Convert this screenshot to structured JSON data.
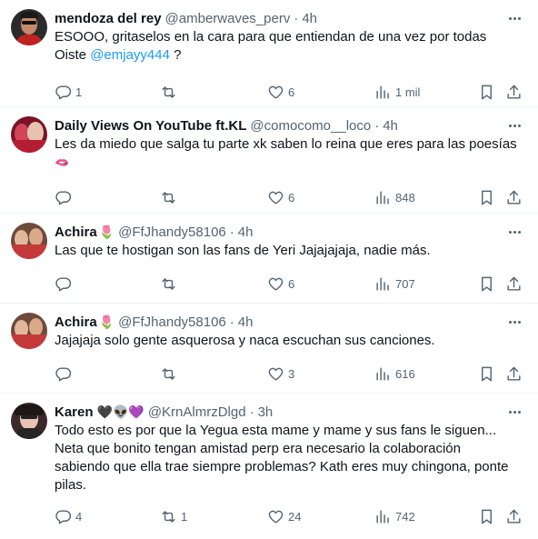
{
  "tweets": [
    {
      "name": "mendoza del rey",
      "name_emoji": "",
      "handle": "@amberwaves_perv",
      "time": "4h",
      "text_lines": [
        "ESOOO, gritaselos en la cara para que entiendan de una vez por todas"
      ],
      "text_line2_prefix": "Oiste ",
      "mention": "@emjayy444",
      "text_line2_suffix": " ?",
      "replies": "1",
      "retweets": "",
      "likes": "6",
      "views": "1 mil"
    },
    {
      "name": "Daily Views On YouTube ft.KL",
      "name_emoji": "",
      "handle": "@comocomo__loco",
      "time": "4h",
      "text_lines": [
        "Les da miedo que salga tu parte xk saben lo reina que eres para las poesías",
        "🫦"
      ],
      "replies": "",
      "retweets": "",
      "likes": "6",
      "views": "848"
    },
    {
      "name": "Achira",
      "name_emoji": "🌷",
      "handle": "@FfJhandy58106",
      "time": "4h",
      "text_lines": [
        "Las que te hostigan son las fans de Yeri Jajajajaja, nadie más."
      ],
      "replies": "",
      "retweets": "",
      "likes": "6",
      "views": "707"
    },
    {
      "name": "Achira",
      "name_emoji": "🌷",
      "handle": "@FfJhandy58106",
      "time": "4h",
      "text_lines": [
        "Jajajaja solo gente asquerosa y naca escuchan sus canciones."
      ],
      "replies": "",
      "retweets": "",
      "likes": "3",
      "views": "616"
    },
    {
      "name": "Karen",
      "name_emoji": "🖤👽💜",
      "handle": "@KrnAlmrzDlgd",
      "time": "3h",
      "text_lines": [
        "Todo esto es por que la Yegua esta mame y mame y sus fans le siguen...",
        "Neta que bonito tengan amistad perp era necesario la colaboración",
        "sabiendo que ella trae siempre problemas? Kath eres muy chingona, ponte",
        "pilas."
      ],
      "replies": "4",
      "retweets": "1",
      "likes": "24",
      "views": "742"
    }
  ],
  "separator": "·",
  "icons": {
    "reply": "reply-icon",
    "retweet": "retweet-icon",
    "like": "heart-icon",
    "views": "views-chart-icon",
    "bookmark": "bookmark-icon",
    "share": "share-icon",
    "more": "more-dots-icon"
  },
  "colors": {
    "text": "#0f1419",
    "muted": "#536471",
    "link": "#1d9bf0",
    "border": "#eff3f4"
  }
}
